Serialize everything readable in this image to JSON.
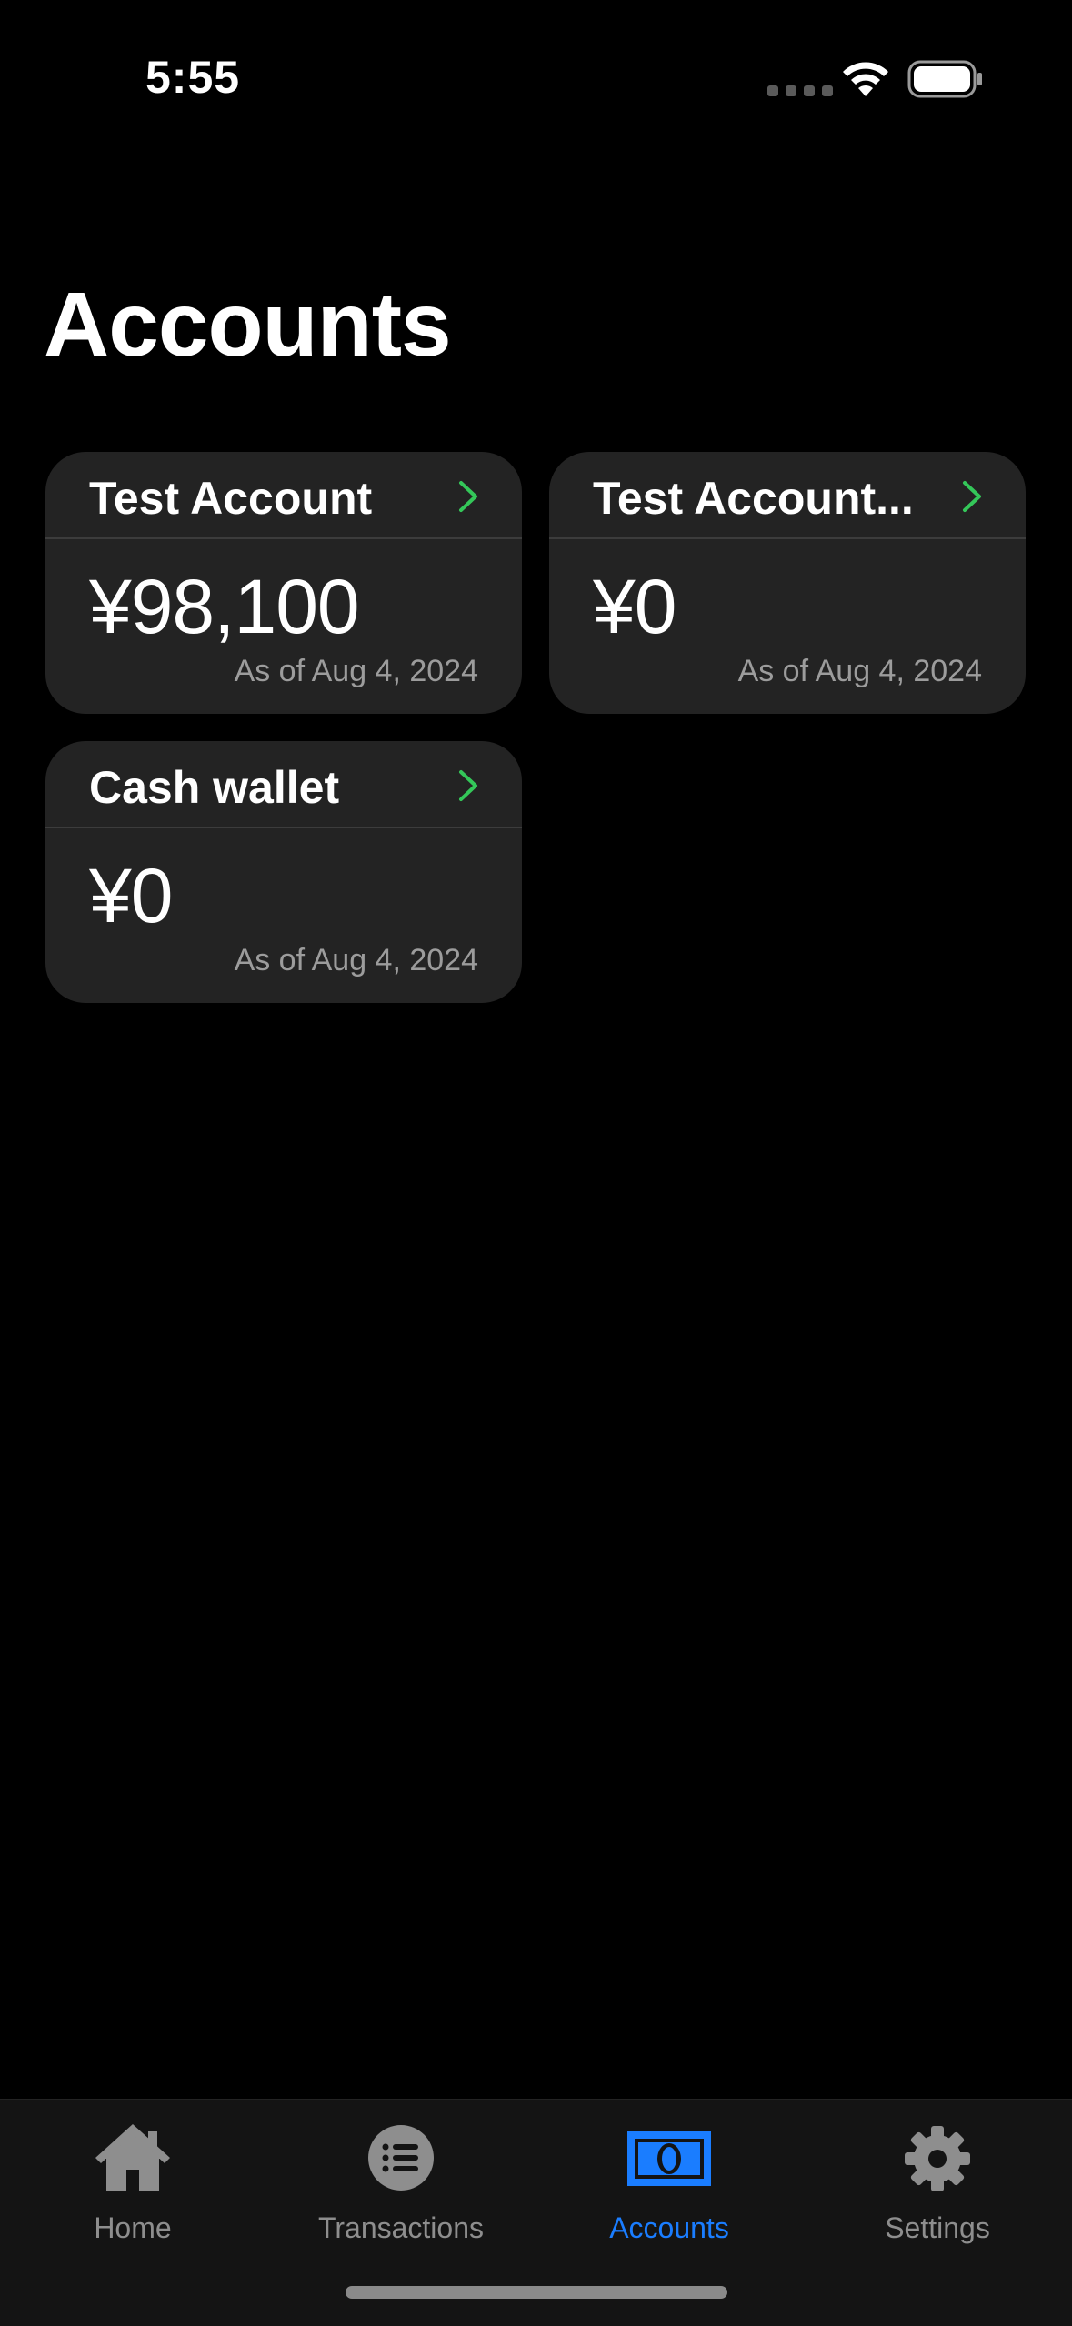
{
  "status_bar": {
    "time": "5:55"
  },
  "page": {
    "title": "Accounts"
  },
  "accounts": [
    {
      "name": "Test Account",
      "balance": "¥98,100",
      "as_of": "As of Aug 4, 2024"
    },
    {
      "name": "Test Account...",
      "balance": "¥0",
      "as_of": "As of Aug 4, 2024"
    },
    {
      "name": "Cash wallet",
      "balance": "¥0",
      "as_of": "As of Aug 4, 2024"
    }
  ],
  "tab_bar": {
    "tabs": [
      {
        "label": "Home",
        "icon": "house-icon",
        "active": false
      },
      {
        "label": "Transactions",
        "icon": "list-icon",
        "active": false
      },
      {
        "label": "Accounts",
        "icon": "banknote-icon",
        "active": true
      },
      {
        "label": "Settings",
        "icon": "gear-icon",
        "active": false
      }
    ]
  },
  "colors": {
    "background": "#000000",
    "card": "#232323",
    "chevron": "#34c759",
    "active_tab": "#1a7dff",
    "inactive_tab": "#8e8e8e"
  }
}
